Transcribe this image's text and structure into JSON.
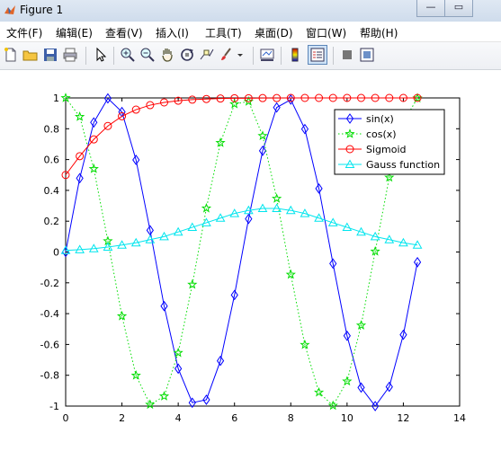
{
  "window": {
    "title": "Figure 1",
    "minimize": "—",
    "maximize": "▭"
  },
  "menu": [
    {
      "label": "文件(F)"
    },
    {
      "label": "编辑(E)"
    },
    {
      "label": "查看(V)"
    },
    {
      "label": "插入(I)"
    },
    {
      "label": "工具(T)"
    },
    {
      "label": "桌面(D)"
    },
    {
      "label": "窗口(W)"
    },
    {
      "label": "帮助(H)"
    }
  ],
  "toolbar_icons": [
    "new-figure-icon",
    "open-file-icon",
    "save-icon",
    "print-icon",
    "select-arrow-icon",
    "zoom-in-icon",
    "zoom-out-icon",
    "pan-hand-icon",
    "rotate-3d-icon",
    "data-cursor-icon",
    "brush-icon",
    "brush-dropdown-icon",
    "link-plot-icon",
    "colorbar-icon",
    "legend-icon",
    "hide-plot-tools-icon",
    "show-plot-tools-icon"
  ],
  "chart_data": {
    "type": "line",
    "xlim": [
      0,
      14
    ],
    "ylim": [
      -1,
      1
    ],
    "xticks": [
      "0",
      "2",
      "4",
      "6",
      "8",
      "10",
      "12",
      "14"
    ],
    "yticks": [
      "-1",
      "-0.8",
      "-0.6",
      "-0.4",
      "-0.2",
      "0",
      "0.2",
      "0.4",
      "0.6",
      "0.8",
      "1"
    ],
    "x": [
      0,
      0.5,
      1,
      1.5,
      2,
      2.5,
      3,
      3.5,
      4,
      4.5,
      5,
      5.5,
      6,
      6.5,
      7,
      7.5,
      8,
      8.5,
      9,
      9.5,
      10,
      10.5,
      11,
      11.5,
      12,
      12.5
    ],
    "legend_position": "top-right",
    "series": [
      {
        "name": "sin(x)",
        "color": "#0000ff",
        "linestyle": "solid",
        "marker": "diamond",
        "values": [
          0,
          0.479,
          0.841,
          0.997,
          0.909,
          0.598,
          0.141,
          -0.351,
          -0.757,
          -0.978,
          -0.959,
          -0.706,
          -0.279,
          0.215,
          0.657,
          0.938,
          0.989,
          0.798,
          0.412,
          -0.075,
          -0.544,
          -0.88,
          -1.0,
          -0.875,
          -0.537,
          -0.066
        ]
      },
      {
        "name": "cos(x)",
        "color": "#00dd00",
        "linestyle": "dotted",
        "marker": "star",
        "values": [
          1,
          0.878,
          0.54,
          0.071,
          -0.416,
          -0.801,
          -0.99,
          -0.936,
          -0.654,
          -0.211,
          0.284,
          0.709,
          0.96,
          0.977,
          0.754,
          0.347,
          -0.146,
          -0.602,
          -0.911,
          -0.997,
          -0.839,
          -0.476,
          0.004,
          0.484,
          0.844,
          0.998
        ]
      },
      {
        "name": "Sigmoid",
        "color": "#ff0000",
        "linestyle": "solid",
        "marker": "circle",
        "values": [
          0.5,
          0.622,
          0.731,
          0.818,
          0.881,
          0.924,
          0.953,
          0.971,
          0.982,
          0.989,
          0.993,
          0.996,
          0.998,
          0.998,
          0.999,
          0.999,
          1,
          1,
          1,
          1,
          1,
          1,
          1,
          1,
          1,
          1
        ]
      },
      {
        "name": "Gauss function",
        "color": "#00e5ee",
        "linestyle": "solid",
        "marker": "triangle",
        "values": [
          0.01,
          0.015,
          0.022,
          0.032,
          0.045,
          0.06,
          0.08,
          0.1,
          0.13,
          0.16,
          0.19,
          0.22,
          0.25,
          0.27,
          0.283,
          0.283,
          0.27,
          0.25,
          0.22,
          0.19,
          0.16,
          0.13,
          0.1,
          0.08,
          0.06,
          0.045
        ]
      }
    ]
  }
}
